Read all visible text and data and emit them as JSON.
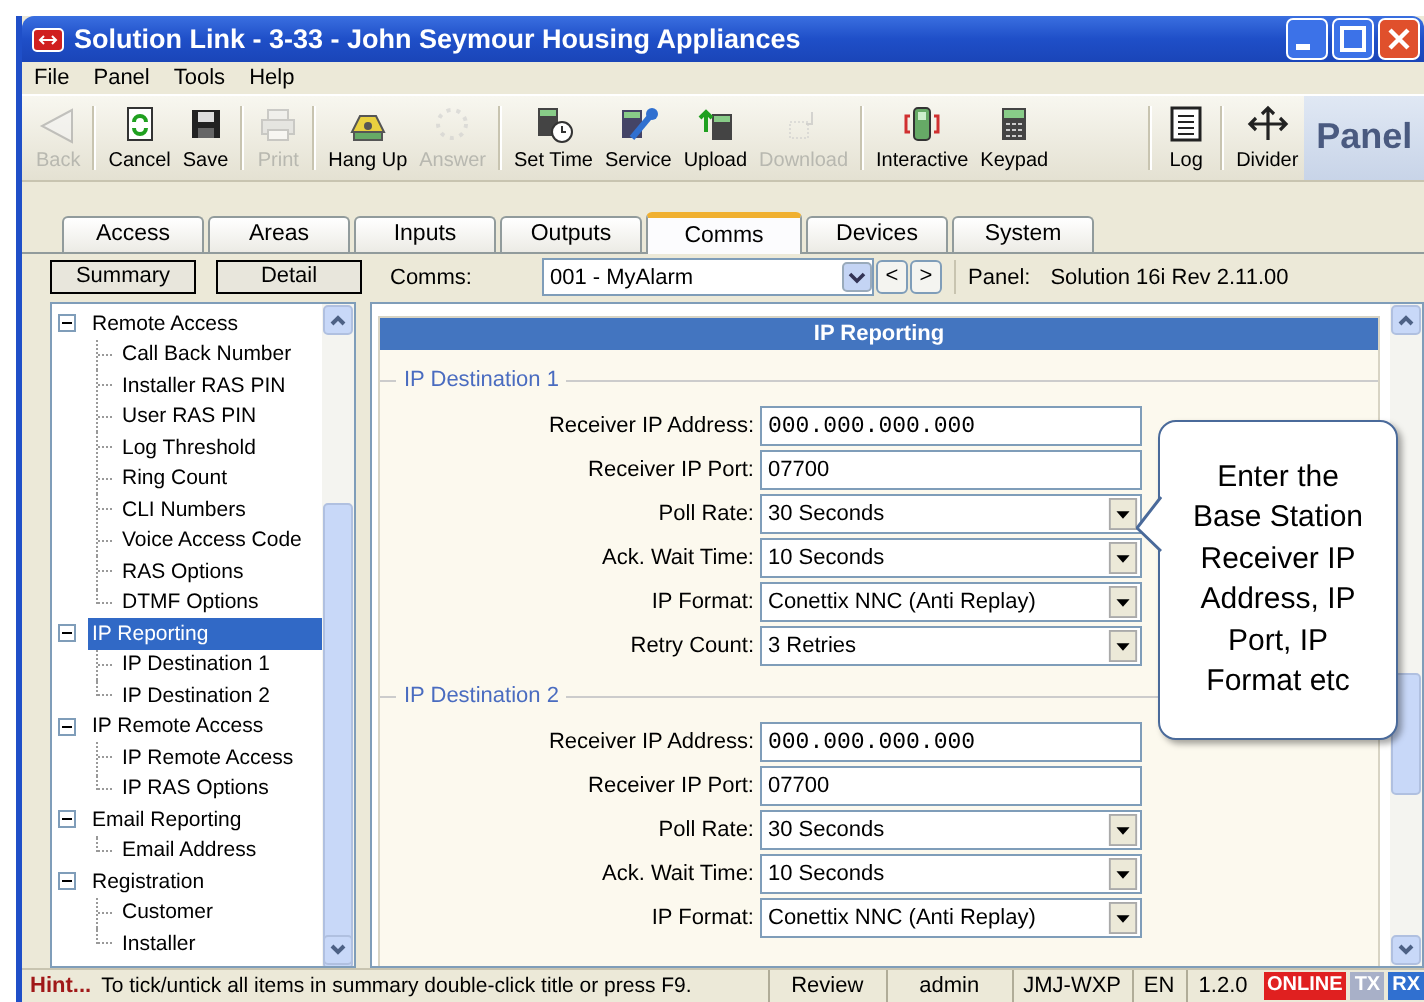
{
  "window": {
    "title": "Solution Link - 3-33 - John Seymour Housing Appliances"
  },
  "menu": [
    "File",
    "Panel",
    "Tools",
    "Help"
  ],
  "toolbar": [
    {
      "label": "Back",
      "disabled": true
    },
    {
      "label": "Cancel",
      "disabled": false
    },
    {
      "label": "Save",
      "disabled": false
    },
    {
      "label": "Print",
      "disabled": true
    },
    {
      "label": "Hang Up",
      "disabled": false
    },
    {
      "label": "Answer",
      "disabled": true
    },
    {
      "label": "Set Time",
      "disabled": false
    },
    {
      "label": "Service",
      "disabled": false
    },
    {
      "label": "Upload",
      "disabled": false
    },
    {
      "label": "Download",
      "disabled": true
    },
    {
      "label": "Interactive",
      "disabled": false
    },
    {
      "label": "Keypad",
      "disabled": false
    },
    {
      "label": "Log",
      "disabled": false
    },
    {
      "label": "Divider",
      "disabled": false
    }
  ],
  "toolbar_title": "Panel",
  "tabs": [
    {
      "label": "Access",
      "selected": false
    },
    {
      "label": "Areas",
      "selected": false
    },
    {
      "label": "Inputs",
      "selected": false
    },
    {
      "label": "Outputs",
      "selected": false
    },
    {
      "label": "Comms",
      "selected": true
    },
    {
      "label": "Devices",
      "selected": false
    },
    {
      "label": "System",
      "selected": false
    }
  ],
  "view_buttons": [
    "Summary",
    "Detail"
  ],
  "comms": {
    "label": "Comms:",
    "value": "001 - MyAlarm",
    "prev": "<",
    "next": ">"
  },
  "panel_info": {
    "label": "Panel:",
    "value": "Solution 16i Rev 2.11.00"
  },
  "tree": [
    {
      "label": "Remote Access",
      "expanded": true,
      "selected": false,
      "children": [
        {
          "label": "Call Back Number",
          "selected": false
        },
        {
          "label": "Installer RAS PIN",
          "selected": false
        },
        {
          "label": "User RAS PIN",
          "selected": false
        },
        {
          "label": "Log Threshold",
          "selected": false
        },
        {
          "label": "Ring Count",
          "selected": false
        },
        {
          "label": "CLI Numbers",
          "selected": false
        },
        {
          "label": "Voice Access Code",
          "selected": false
        },
        {
          "label": "RAS Options",
          "selected": false
        },
        {
          "label": "DTMF Options",
          "selected": false
        }
      ]
    },
    {
      "label": "IP Reporting",
      "expanded": true,
      "selected": true,
      "children": [
        {
          "label": "IP Destination 1",
          "selected": false
        },
        {
          "label": "IP Destination 2",
          "selected": false
        }
      ]
    },
    {
      "label": "IP Remote Access",
      "expanded": true,
      "selected": false,
      "children": [
        {
          "label": "IP Remote Access",
          "selected": false
        },
        {
          "label": "IP RAS Options",
          "selected": false
        }
      ]
    },
    {
      "label": "Email Reporting",
      "expanded": true,
      "selected": false,
      "children": [
        {
          "label": "Email Address",
          "selected": false
        }
      ]
    },
    {
      "label": "Registration",
      "expanded": true,
      "selected": false,
      "children": [
        {
          "label": "Customer",
          "selected": false
        },
        {
          "label": "Installer",
          "selected": false
        }
      ]
    }
  ],
  "form": {
    "title": "IP Reporting",
    "groups": [
      {
        "title": "IP Destination 1",
        "fields": [
          {
            "label": "Receiver IP Address:",
            "value": "000.000.000.000",
            "kind": "address"
          },
          {
            "label": "Receiver IP Port:",
            "value": "07700",
            "kind": "text"
          },
          {
            "label": "Poll Rate:",
            "value": "30 Seconds",
            "kind": "select"
          },
          {
            "label": "Ack. Wait Time:",
            "value": "10 Seconds",
            "kind": "select"
          },
          {
            "label": "IP Format:",
            "value": "Conettix NNC (Anti Replay)",
            "kind": "select"
          },
          {
            "label": "Retry Count:",
            "value": "3 Retries",
            "kind": "select"
          }
        ]
      },
      {
        "title": "IP Destination 2",
        "fields": [
          {
            "label": "Receiver IP Address:",
            "value": "000.000.000.000",
            "kind": "address"
          },
          {
            "label": "Receiver IP Port:",
            "value": "07700",
            "kind": "text"
          },
          {
            "label": "Poll Rate:",
            "value": "30 Seconds",
            "kind": "select"
          },
          {
            "label": "Ack. Wait Time:",
            "value": "10 Seconds",
            "kind": "select"
          },
          {
            "label": "IP Format:",
            "value": "Conettix NNC (Anti Replay)",
            "kind": "select"
          }
        ]
      }
    ]
  },
  "callout": "Enter the\nBase Station\nReceiver IP\nAddress, IP\nPort, IP\nFormat etc",
  "status_bar": {
    "hint": "Hint...",
    "message": "To tick/untick all items in summary double-click title or press F9.",
    "cells": [
      "Review",
      "admin",
      "JMJ-WXP",
      "EN",
      "1.2.0"
    ],
    "indicators": [
      {
        "label": "ONLINE",
        "color": "#e02020"
      },
      {
        "label": "TX",
        "color": "#a8b0c8"
      },
      {
        "label": "RX",
        "color": "#3070d0"
      }
    ]
  }
}
